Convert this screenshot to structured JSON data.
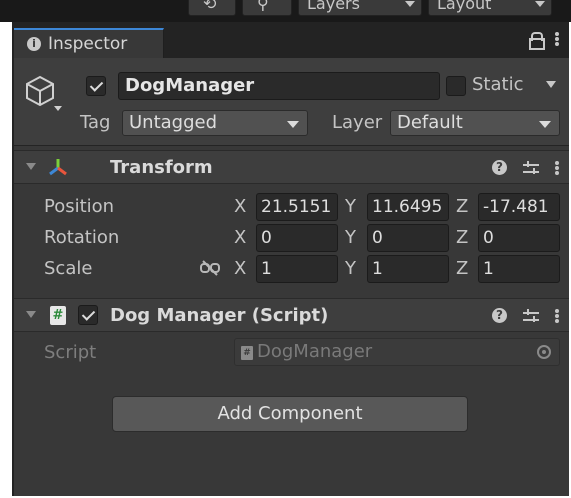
{
  "toolbar": {
    "layers_label": "Layers",
    "layout_label": "Layout"
  },
  "tab": {
    "title": "Inspector"
  },
  "game_object": {
    "active": true,
    "name": "DogManager",
    "static_label": "Static",
    "static_checked": false,
    "tag_label": "Tag",
    "tag_value": "Untagged",
    "layer_label": "Layer",
    "layer_value": "Default"
  },
  "transform": {
    "title": "Transform",
    "position_label": "Position",
    "rotation_label": "Rotation",
    "scale_label": "Scale",
    "axis_x": "X",
    "axis_y": "Y",
    "axis_z": "Z",
    "position": {
      "x": "21.5151",
      "y": "11.6495",
      "z": "-17.481"
    },
    "rotation": {
      "x": "0",
      "y": "0",
      "z": "0"
    },
    "scale": {
      "x": "1",
      "y": "1",
      "z": "1"
    }
  },
  "script_component": {
    "title": "Dog Manager (Script)",
    "enabled": true,
    "script_label": "Script",
    "script_value": "DogManager"
  },
  "add_component_label": "Add Component",
  "colors": {
    "background": "#383838",
    "header": "#3e3e3e",
    "field": "#2a2a2a",
    "tab_accent": "#3d87d6",
    "button": "#585858"
  }
}
